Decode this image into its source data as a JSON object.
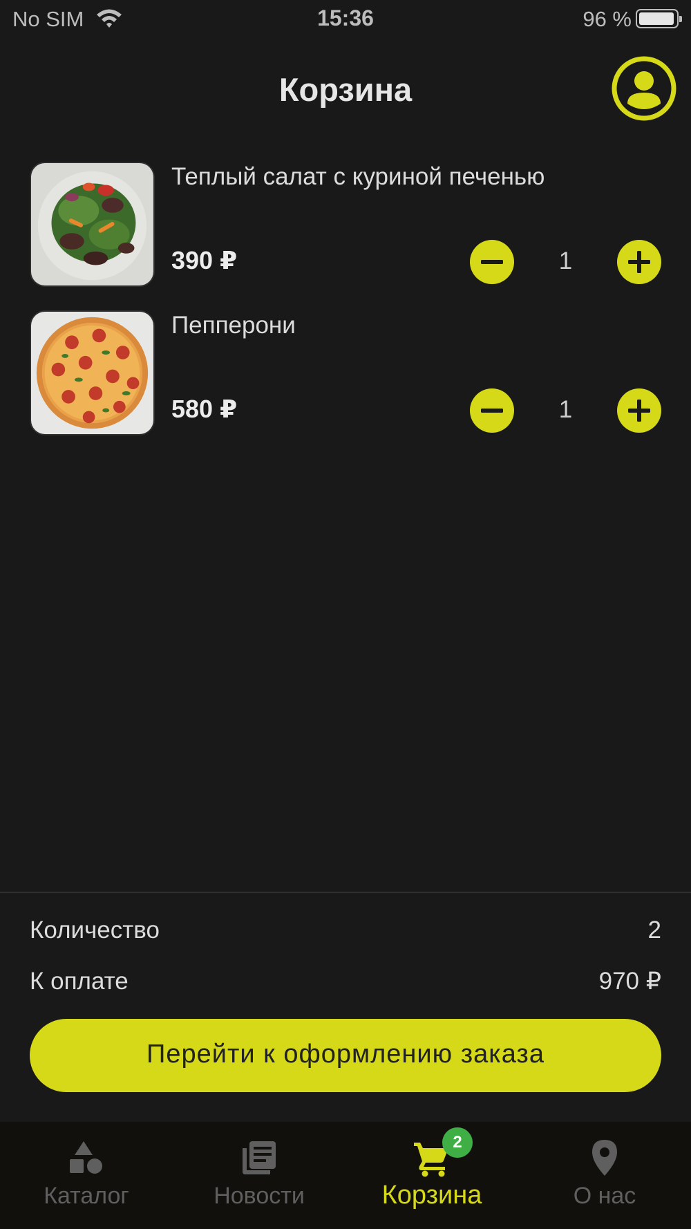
{
  "status_bar": {
    "carrier": "No SIM",
    "time": "15:36",
    "battery_text": "96 %",
    "battery_level": 0.96
  },
  "header": {
    "title": "Корзина",
    "profile_icon": "user-circle-icon"
  },
  "cart": {
    "items": [
      {
        "name": "Теплый салат с куриной печенью",
        "price": "390 ₽",
        "quantity": "1",
        "image": "warm-salad-photo"
      },
      {
        "name": "Пепперони",
        "price": "580 ₽",
        "quantity": "1",
        "image": "pepperoni-pizza-photo"
      }
    ]
  },
  "summary": {
    "count_label": "Количество",
    "count_value": "2",
    "total_label": "К оплате",
    "total_value": "970 ₽",
    "checkout_label": "Перейти к оформлению заказа"
  },
  "tab_bar": {
    "tabs": [
      {
        "label": "Каталог",
        "icon": "shapes-icon",
        "active": false
      },
      {
        "label": "Новости",
        "icon": "news-icon",
        "active": false
      },
      {
        "label": "Корзина",
        "icon": "cart-icon",
        "active": true,
        "badge": "2"
      },
      {
        "label": "О нас",
        "icon": "location-pin-icon",
        "active": false
      }
    ]
  },
  "colors": {
    "background": "#191919",
    "accent": "#d6d918",
    "badge": "#3fae45",
    "tab_bar_bg": "#12100d",
    "inactive_tab": "#5f5f5f"
  }
}
